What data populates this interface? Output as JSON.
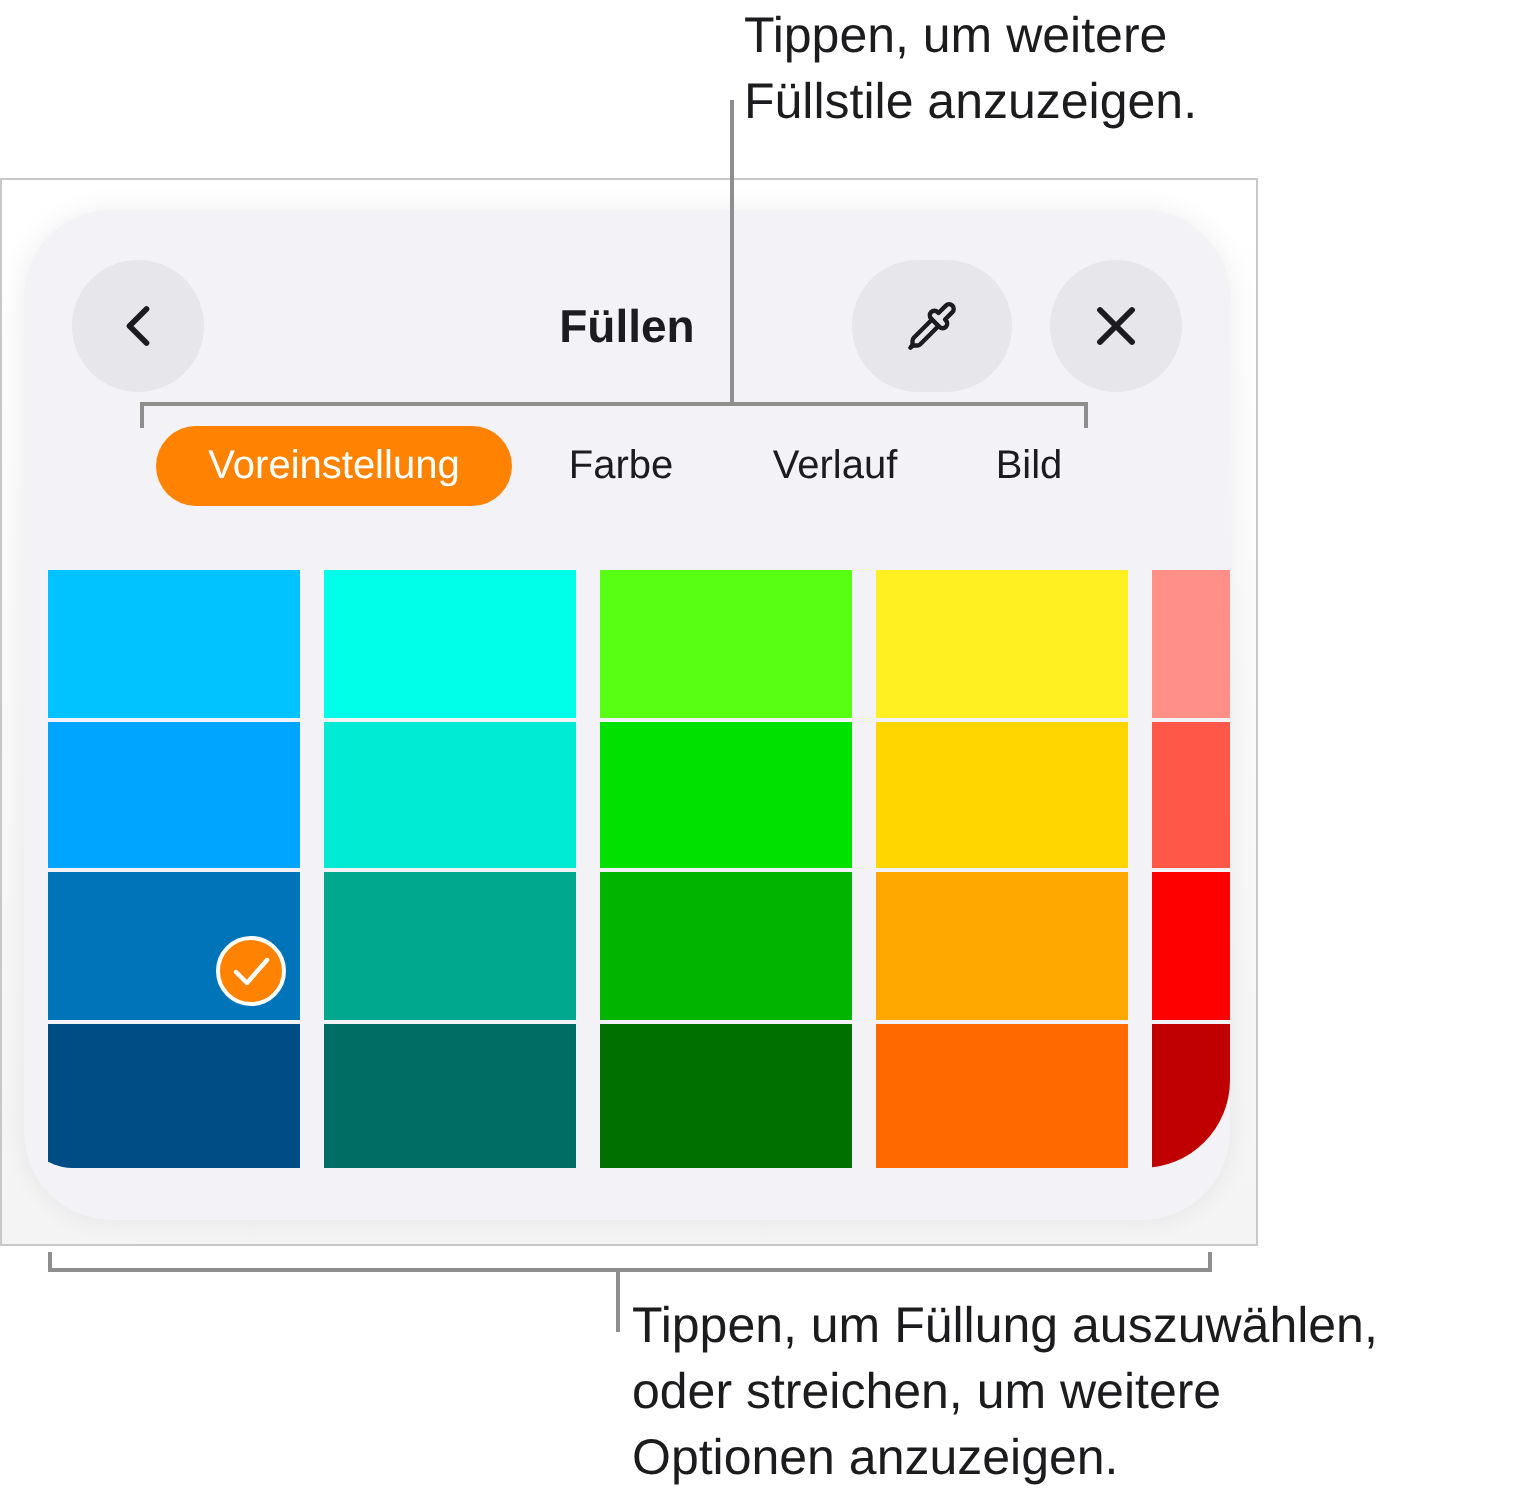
{
  "callout_top": {
    "lines": [
      "Tippen, um weitere",
      "Füllstile anzuzeigen."
    ]
  },
  "panel": {
    "title": "Füllen",
    "tabs": [
      {
        "label": "Voreinstellung",
        "selected": true
      },
      {
        "label": "Farbe",
        "selected": false
      },
      {
        "label": "Verlauf",
        "selected": false
      },
      {
        "label": "Bild",
        "selected": false
      }
    ],
    "swatch_columns": [
      {
        "cells": [
          {
            "color": "#00c3ff",
            "selected": false
          },
          {
            "color": "#00a5ff",
            "selected": false
          },
          {
            "color": "#0074b8",
            "selected": true
          },
          {
            "color": "#004d85",
            "selected": false
          }
        ]
      },
      {
        "cells": [
          {
            "color": "#00ffe9",
            "selected": false
          },
          {
            "color": "#00ebd3",
            "selected": false
          },
          {
            "color": "#00a88d",
            "selected": false
          },
          {
            "color": "#006d64",
            "selected": false
          }
        ]
      },
      {
        "cells": [
          {
            "color": "#58ff12",
            "selected": false
          },
          {
            "color": "#00e100",
            "selected": false
          },
          {
            "color": "#00b400",
            "selected": false
          },
          {
            "color": "#007100",
            "selected": false
          }
        ]
      },
      {
        "cells": [
          {
            "color": "#fff021",
            "selected": false
          },
          {
            "color": "#ffd600",
            "selected": false
          },
          {
            "color": "#ffa800",
            "selected": false
          },
          {
            "color": "#ff6900",
            "selected": false
          }
        ]
      },
      {
        "cells": [
          {
            "color": "#ff8f87",
            "selected": false
          },
          {
            "color": "#ff5748",
            "selected": false
          },
          {
            "color": "#ff0000",
            "selected": false
          },
          {
            "color": "#c00000",
            "selected": false
          }
        ]
      }
    ]
  },
  "callout_bottom": {
    "lines": [
      "Tippen, um Füllung auszuwählen,",
      "oder streichen, um weitere",
      "Optionen anzuzeigen."
    ]
  }
}
